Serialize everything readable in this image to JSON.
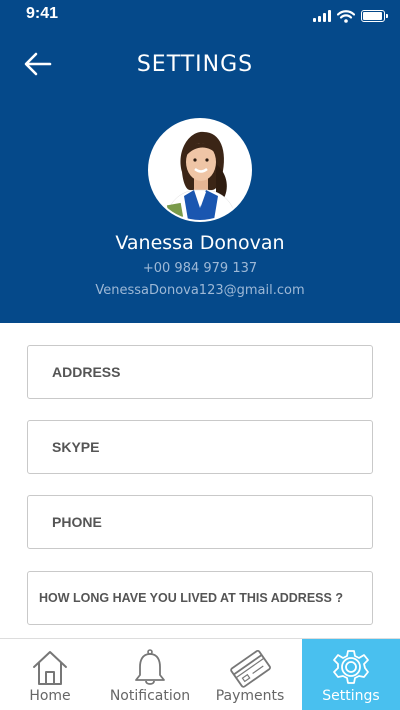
{
  "status_bar": {
    "time": "9:41"
  },
  "header": {
    "title": "SETTINGS"
  },
  "profile": {
    "name": "Vanessa Donovan",
    "phone": "+00 984 979 137",
    "email": "VenessaDonova123@gmail.com"
  },
  "form": {
    "fields": [
      {
        "label": "ADDRESS"
      },
      {
        "label": "SKYPE"
      },
      {
        "label": "PHONE"
      },
      {
        "label": "HOW  LONG HAVE YOU LIVED AT THIS  ADDRESS ?"
      }
    ]
  },
  "tabs": [
    {
      "label": "Home",
      "icon": "home-icon"
    },
    {
      "label": "Notification",
      "icon": "bell-icon"
    },
    {
      "label": "Payments",
      "icon": "credit-card-icon"
    },
    {
      "label": "Settings",
      "icon": "gear-icon",
      "active": true
    }
  ],
  "colors": {
    "header_bg": "#05498a",
    "active_tab_bg": "#49c0ef",
    "field_border": "#c9c9c9"
  }
}
